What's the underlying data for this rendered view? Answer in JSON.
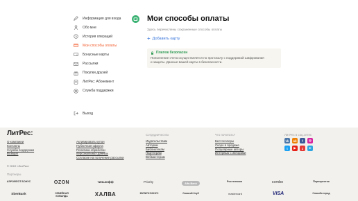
{
  "sidebar": {
    "items": [
      {
        "label": "Информация для входа",
        "icon": "pencil-icon"
      },
      {
        "label": "Обо мне",
        "icon": "user-icon"
      },
      {
        "label": "История операций",
        "icon": "history-icon"
      },
      {
        "label": "Мои способы оплаты",
        "icon": "card-icon",
        "active": true
      },
      {
        "label": "Бонусные карты",
        "icon": "bonus-card-icon"
      },
      {
        "label": "Рассылки",
        "icon": "mail-icon"
      },
      {
        "label": "Покупки друзей",
        "icon": "gift-icon"
      },
      {
        "label": "ЛитРес: Абонемент",
        "icon": "subscription-icon"
      },
      {
        "label": "Служба поддержки",
        "icon": "support-icon"
      }
    ],
    "logout_label": "Выход"
  },
  "main": {
    "title": "Мои способы оплаты",
    "description": "Здесь перечислены сохраненные способы оплаты",
    "add_card_label": "Добавить карту",
    "security": {
      "title": "Платеж безопасен",
      "text_line1": "Пополнение счета осуществляется по протоколу с поддержкой шифрования",
      "text_line2": "и защиты. Данные вашей карты в безопасности."
    }
  },
  "footer": {
    "logo": "ЛитРес:",
    "col1": [
      "О компании",
      "Контакты",
      "Служба поддержки",
      "Возврат"
    ],
    "col2": [
      "Активировать купон",
      "Публичная оферта",
      "Политика обработки",
      "персональных данных",
      "Согласие на получение рассылки"
    ],
    "col3_title": "Сотрудничество",
    "col3": [
      "Издательствам",
      "Авторам",
      "Библиотекам",
      "Партнерам",
      "Вебмастерам"
    ],
    "col4_title": "Что почитать?",
    "col4": [
      "Бестселлеры",
      "Скоро в продаже",
      "Популярные авторы",
      "Интервью с авторами"
    ],
    "social_title": "ЛитРес в соц.сетях",
    "social": [
      {
        "name": "vk-icon",
        "glyph": "vk",
        "color": "#4a76a8"
      },
      {
        "name": "ok-icon",
        "glyph": "ok",
        "color": "#ee8208"
      },
      {
        "name": "facebook-icon",
        "glyph": "f",
        "color": "#3b5998"
      },
      {
        "name": "instagram-icon",
        "glyph": "◎",
        "color": "#d6249f"
      },
      {
        "name": "twitter-icon",
        "glyph": "t",
        "color": "#1da1f2"
      },
      {
        "name": "youtube-icon",
        "glyph": "▶",
        "color": "#e62117"
      },
      {
        "name": "zen-icon",
        "glyph": "z",
        "color": "#e53935"
      },
      {
        "name": "telegram-icon",
        "glyph": "➤",
        "color": "#2ca5e0"
      }
    ],
    "copyright": "© ООО «ЛитРес»",
    "partners_title": "Партнеры",
    "partners_row1": [
      "АЭРОФЛОТ БОНУС",
      "OZON",
      "тинькофф",
      "Priority",
      "Alfa-Bank",
      "Ростелеком",
      "combo",
      "Перекресток"
    ],
    "partners_row2": [
      "SberBank",
      "СЕМЕЙНАЯ КОМАНДА",
      "ХАЛВА",
      "МУЛЬТИ БОНУС",
      "Связной Клуб",
      "mastercard",
      "VISA",
      "Спасибо город"
    ]
  }
}
